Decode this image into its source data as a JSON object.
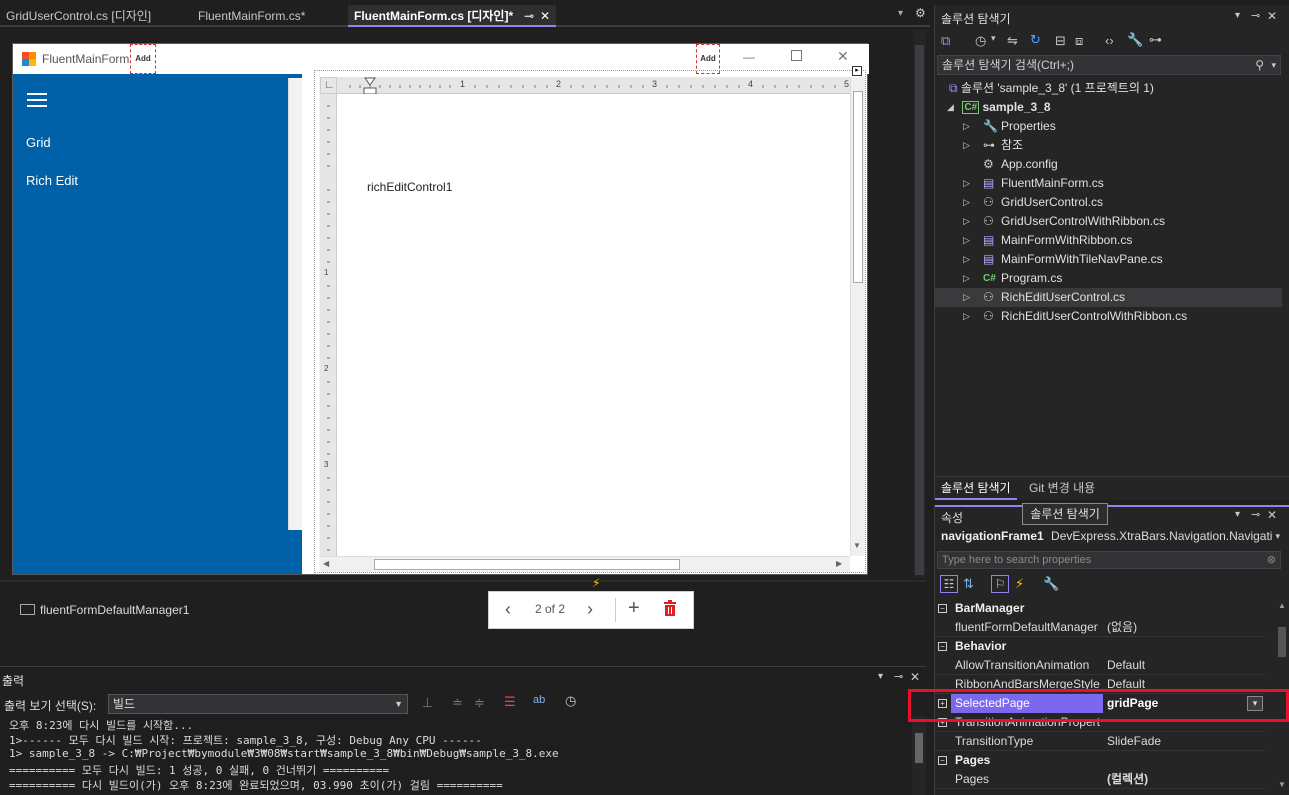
{
  "tabs": [
    {
      "label": "GridUserControl.cs [디자인]",
      "active": false
    },
    {
      "label": "FluentMainForm.cs*",
      "active": false
    },
    {
      "label": "FluentMainForm.cs [디자인]*",
      "active": true
    }
  ],
  "form": {
    "title": "FluentMainForm",
    "add_label": "Add",
    "nav_items": [
      "Grid",
      "Rich Edit"
    ],
    "rich_edit_text": "richEditControl1",
    "ruler_marks": [
      "1",
      "2",
      "3",
      "4",
      "5"
    ],
    "vruler_marks": [
      "1",
      "2",
      "3"
    ]
  },
  "tray": {
    "component": "fluentFormDefaultManager1"
  },
  "pager": {
    "text": "2 of 2"
  },
  "output": {
    "title": "출력",
    "show_label": "출력 보기 선택(S):",
    "source": "빌드",
    "lines": [
      "오후 8:23에 다시 빌드를 시작함...",
      "1>------ 모두 다시 빌드 시작: 프로젝트: sample_3_8, 구성: Debug Any CPU ------",
      "1>  sample_3_8 -> C:₩Project₩bymodule₩3₩08₩start₩sample_3_8₩bin₩Debug₩sample_3_8.exe",
      "========== 모두 다시 빌드: 1 성공, 0 실패, 0 건너뛰기 ==========",
      "========== 다시 빌드이(가) 오후 8:23에 완료되었으며, 03.990 초이(가) 걸림 =========="
    ]
  },
  "solution_explorer": {
    "title": "솔루션 탐색기",
    "search_placeholder": "솔루션 탐색기 검색(Ctrl+;)",
    "solution": "솔루션 'sample_3_8' (1 프로젝트의 1)",
    "project": "sample_3_8",
    "items": [
      {
        "label": "Properties",
        "icon": "wrench-icon",
        "expandable": true
      },
      {
        "label": "참조",
        "icon": "references-icon",
        "expandable": true
      },
      {
        "label": "App.config",
        "icon": "config-icon",
        "expandable": false
      },
      {
        "label": "FluentMainForm.cs",
        "icon": "form-icon",
        "expandable": true
      },
      {
        "label": "GridUserControl.cs",
        "icon": "usercontrol-icon",
        "expandable": true
      },
      {
        "label": "GridUserControlWithRibbon.cs",
        "icon": "usercontrol-icon",
        "expandable": true
      },
      {
        "label": "MainFormWithRibbon.cs",
        "icon": "form-icon",
        "expandable": true
      },
      {
        "label": "MainFormWithTileNavPane.cs",
        "icon": "form-icon",
        "expandable": true
      },
      {
        "label": "Program.cs",
        "icon": "csharp-icon",
        "expandable": true
      },
      {
        "label": "RichEditUserControl.cs",
        "icon": "usercontrol-icon",
        "expandable": true,
        "selected": true
      },
      {
        "label": "RichEditUserControlWithRibbon.cs",
        "icon": "usercontrol-icon",
        "expandable": true
      }
    ],
    "bottom_tabs": [
      "솔루션 탐색기",
      "Git 변경 내용"
    ],
    "tooltip": "솔루션 탐색기"
  },
  "properties": {
    "title": "속성",
    "object_name": "navigationFrame1",
    "object_type": "DevExpress.XtraBars.Navigation.Navigati",
    "search_placeholder": "Type here to search properties",
    "rows": [
      {
        "kind": "cat",
        "name": "BarManager"
      },
      {
        "kind": "prop",
        "name": "fluentFormDefaultManager",
        "value": "(없음)"
      },
      {
        "kind": "cat",
        "name": "Behavior"
      },
      {
        "kind": "prop",
        "name": "AllowTransitionAnimation",
        "value": "Default"
      },
      {
        "kind": "prop",
        "name": "RibbonAndBarsMergeStyle",
        "value": "Default"
      },
      {
        "kind": "sel",
        "name": "SelectedPage",
        "value": "gridPage"
      },
      {
        "kind": "prop",
        "name": "TransitionAnimationPropert",
        "value": ""
      },
      {
        "kind": "prop",
        "name": "TransitionType",
        "value": "SlideFade"
      },
      {
        "kind": "cat",
        "name": "Pages"
      },
      {
        "kind": "prop",
        "name": "Pages",
        "value": "(컬렉션)"
      }
    ]
  },
  "colors": {
    "accent": "#9184ee",
    "nav_blue": "#0060a8",
    "highlight_red": "#e8102a",
    "selected_prop": "#7b68ee"
  }
}
